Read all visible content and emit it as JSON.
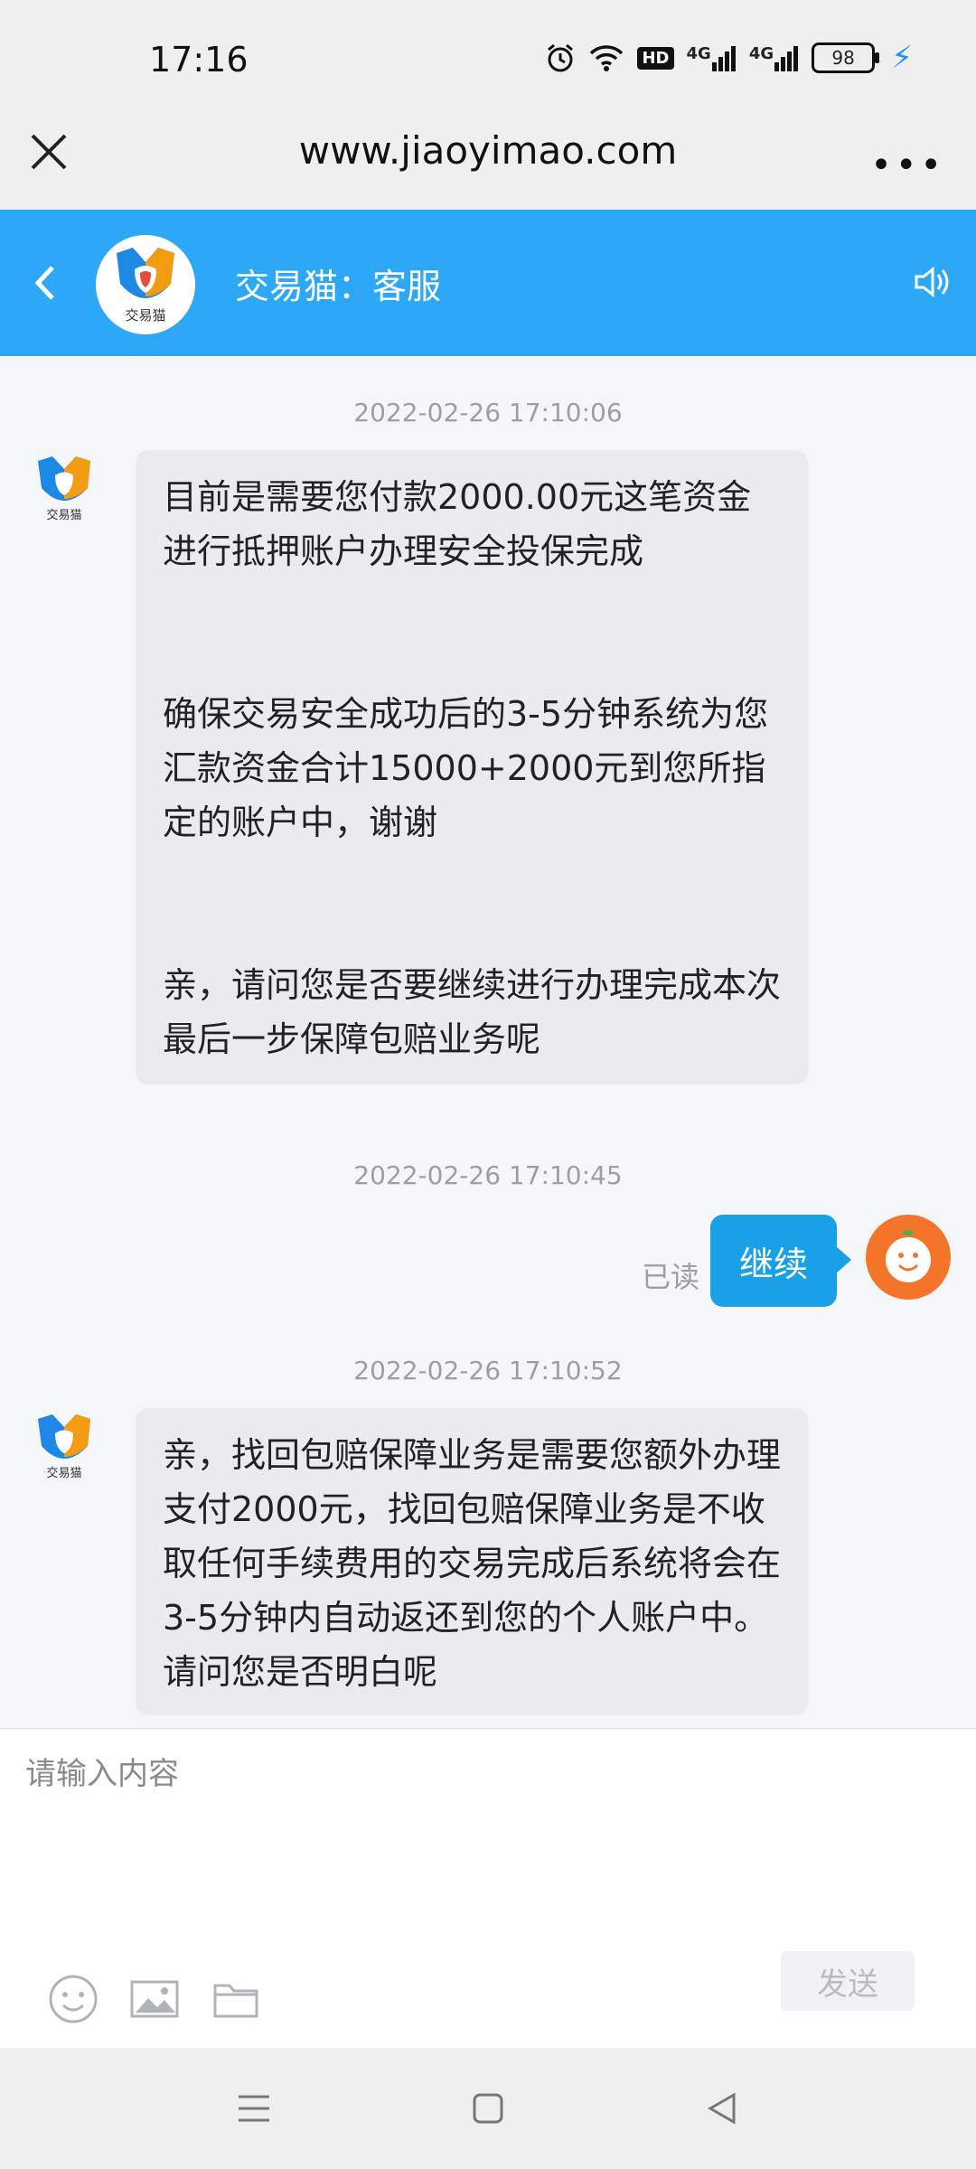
{
  "status_bar": {
    "time": "17:16",
    "hd_label": "HD",
    "network_1": "4G",
    "network_2": "4G",
    "battery": "98"
  },
  "browser": {
    "url": "www.jiaoyimao.com",
    "more_label": "•••"
  },
  "chat_header": {
    "title": "交易猫：客服",
    "logo_text": "交易猫"
  },
  "messages": [
    {
      "timestamp": "2022-02-26 17:10:06",
      "sender": "agent",
      "paragraphs": [
        "目前是需要您付款2000.00元这笔资金进行抵押账户办理安全投保完成",
        "确保交易安全成功后的3-5分钟系统为您汇款资金合计15000+2000元到您所指定的账户中，谢谢",
        "亲，请问您是否要继续进行办理完成本次最后一步保障包赔业务呢"
      ]
    },
    {
      "timestamp": "2022-02-26 17:10:45",
      "sender": "user",
      "text": "继续",
      "read_label": "已读"
    },
    {
      "timestamp": "2022-02-26 17:10:52",
      "sender": "agent",
      "paragraphs": [
        "亲，找回包赔保障业务是需要您额外办理支付2000元，找回包赔保障业务是不收取任何手续费用的交易完成后系统将会在3-5分钟内自动返还到您的个人账户中。请问您是否明白呢"
      ]
    }
  ],
  "composer": {
    "placeholder": "请输入内容",
    "send_label": "发送"
  },
  "colors": {
    "header_blue": "#2da8f6",
    "user_bubble": "#1aa0e6",
    "agent_bubble": "#e9ecef"
  }
}
